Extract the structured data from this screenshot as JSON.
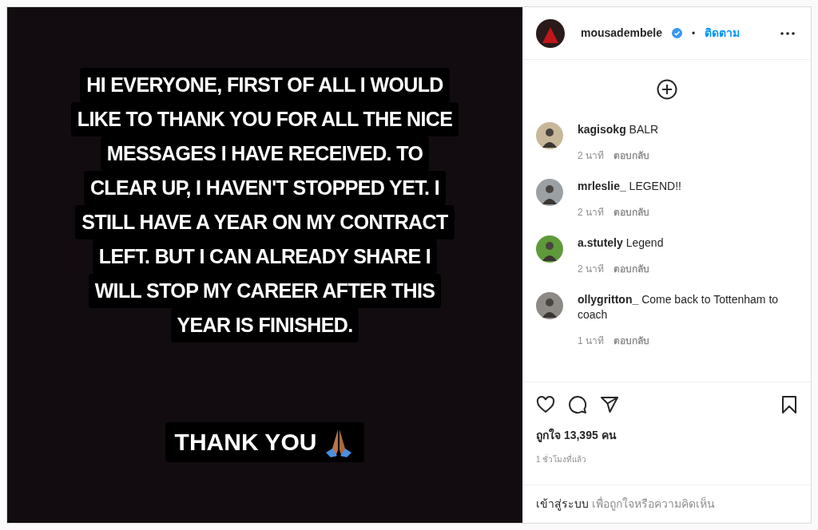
{
  "post": {
    "kind": "text_story",
    "lines": [
      "HI EVERYONE, FIRST OF ALL I WOULD",
      "LIKE TO THANK YOU FOR ALL THE NICE",
      "MESSAGES I HAVE RECEIVED. TO",
      "CLEAR UP, I HAVEN'T STOPPED YET. I",
      "STILL HAVE A YEAR ON MY CONTRACT",
      "LEFT. BUT I CAN ALREADY SHARE I",
      "WILL STOP MY CAREER AFTER THIS",
      "YEAR IS FINISHED."
    ],
    "closing": "THANK YOU"
  },
  "header": {
    "username": "mousadembele",
    "verified": true,
    "separator": "•",
    "follow": "ติดตาม"
  },
  "comments": [
    {
      "username": "kagisokg",
      "text": "BALR",
      "time": "2 นาที",
      "reply": "ตอบกลับ"
    },
    {
      "username": "mrleslie_",
      "text": "LEGEND!!",
      "time": "2 นาที",
      "reply": "ตอบกลับ"
    },
    {
      "username": "a.stutely",
      "text": "Legend",
      "time": "2 นาที",
      "reply": "ตอบกลับ"
    },
    {
      "username": "ollygritton_",
      "text": "Come back to Tottenham to coach",
      "time": "1 นาที",
      "reply": "ตอบกลับ"
    }
  ],
  "likes": "ถูกใจ 13,395 คน",
  "posted": "1 ชั่วโมงที่แล้ว",
  "login": {
    "link": "เข้าสู่ระบบ",
    "text": "เพื่อถูกใจหรือความคิดเห็น"
  }
}
